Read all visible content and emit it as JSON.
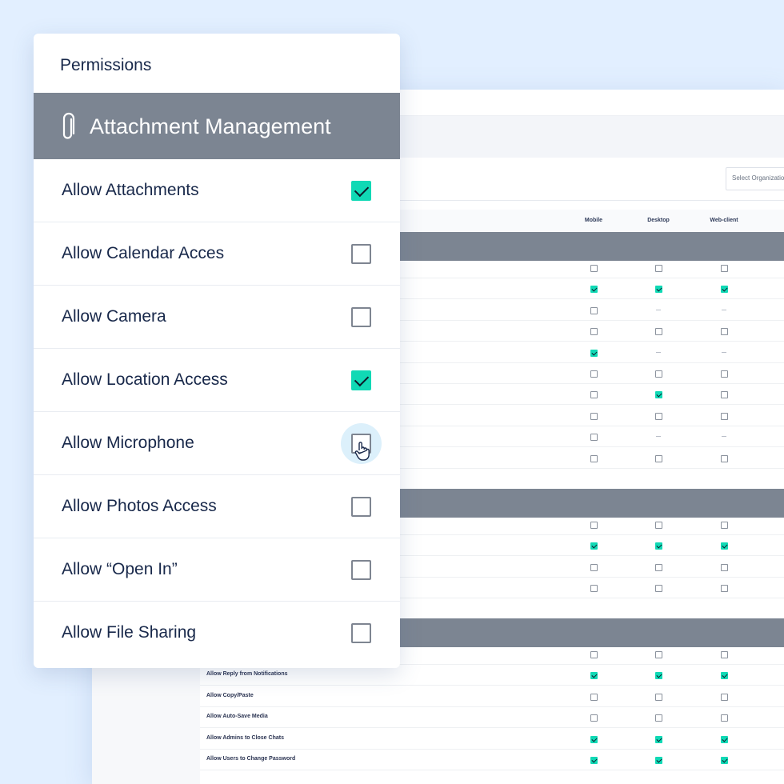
{
  "background": {
    "org_select_placeholder": "Select Organization",
    "columns": [
      "Mobile",
      "Desktop",
      "Web-client"
    ],
    "group1_rows": [
      {
        "label": "",
        "states": [
          "off",
          "off",
          "off"
        ]
      },
      {
        "label": "",
        "states": [
          "on",
          "on",
          "on"
        ]
      },
      {
        "label": "",
        "states": [
          "off",
          "na",
          "na"
        ]
      },
      {
        "label": "",
        "states": [
          "off",
          "off",
          "off"
        ]
      },
      {
        "label": "",
        "states": [
          "on",
          "na",
          "na"
        ]
      },
      {
        "label": "",
        "states": [
          "off",
          "off",
          "off"
        ]
      },
      {
        "label": "",
        "states": [
          "off",
          "on",
          "off"
        ]
      },
      {
        "label": "",
        "states": [
          "off",
          "off",
          "off"
        ]
      },
      {
        "label": "",
        "states": [
          "off",
          "na",
          "na"
        ]
      },
      {
        "label": "",
        "states": [
          "off",
          "off",
          "off"
        ]
      }
    ],
    "group2_rows": [
      {
        "label": "",
        "states": [
          "off",
          "off",
          "off"
        ]
      },
      {
        "label": "",
        "states": [
          "on",
          "on",
          "on"
        ]
      },
      {
        "label": "",
        "states": [
          "off",
          "off",
          "off"
        ]
      },
      {
        "label": "",
        "states": [
          "off",
          "off",
          "off"
        ]
      }
    ],
    "group3_rows": [
      {
        "label": "",
        "states": [
          "hover",
          "off",
          "off"
        ]
      },
      {
        "label": "Allow Reply from Notifications",
        "states": [
          "on",
          "on",
          "on"
        ]
      },
      {
        "label": "Allow Copy/Paste",
        "states": [
          "off",
          "off",
          "off"
        ]
      },
      {
        "label": "Allow Auto-Save Media",
        "states": [
          "off",
          "off",
          "off"
        ]
      },
      {
        "label": "Allow Admins to Close Chats",
        "states": [
          "on",
          "on",
          "on"
        ]
      },
      {
        "label": "Allow Users to Change Password",
        "states": [
          "on",
          "on",
          "on"
        ]
      }
    ]
  },
  "panel": {
    "title": "Permissions",
    "section_icon": "paperclip-icon",
    "section_title": "Attachment Management",
    "items": [
      {
        "label": "Allow Attachments",
        "checked": true
      },
      {
        "label": "Allow Calendar Acces",
        "checked": false
      },
      {
        "label": "Allow Camera",
        "checked": false
      },
      {
        "label": "Allow Location Access",
        "checked": true
      },
      {
        "label": "Allow Microphone",
        "checked": false,
        "hovered": true
      },
      {
        "label": "Allow Photos Access",
        "checked": false
      },
      {
        "label": "Allow “Open In”",
        "checked": false
      },
      {
        "label": "Allow File Sharing",
        "checked": false
      }
    ]
  },
  "colors": {
    "accent": "#10d9b5",
    "header_bar": "#7c8592",
    "text": "#18284a",
    "page_bg": "#e2efff"
  }
}
